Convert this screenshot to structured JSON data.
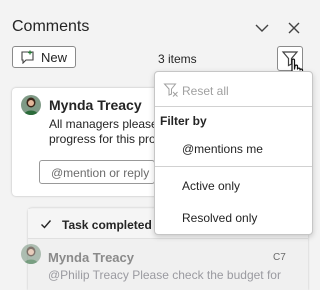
{
  "pane": {
    "title": "Comments",
    "new_label": "New",
    "items_count": "3 items"
  },
  "thread1": {
    "author": "Mynda Treacy",
    "body": "All managers please\nprogress for this pro",
    "reply_placeholder": "@mention or reply"
  },
  "thread2": {
    "status": "Task completed",
    "author": "Mynda Treacy",
    "ref": "C7",
    "body": "@Philip Treacy Please check the budget for"
  },
  "filter_menu": {
    "reset": "Reset all",
    "heading": "Filter by",
    "options": [
      "@mentions me",
      "Active only",
      "Resolved only"
    ]
  }
}
